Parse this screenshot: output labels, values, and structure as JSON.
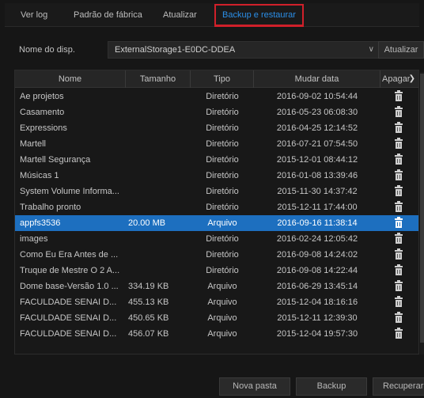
{
  "tabs": [
    {
      "label": "Ver log"
    },
    {
      "label": "Padrão de fábrica"
    },
    {
      "label": "Atualizar"
    },
    {
      "label": "Backup e restaurar",
      "active": true
    }
  ],
  "device": {
    "label": "Nome do disp.",
    "selected": "ExternalStorage1-E0DC-DDEA",
    "refresh_label": "Atualizar"
  },
  "table": {
    "columns": [
      "Nome",
      "Tamanho",
      "Tipo",
      "Mudar data",
      "Apagar"
    ],
    "rows": [
      {
        "name": "Ae projetos",
        "size": "",
        "type": "Diretório",
        "date": "2016-09-02 10:54:44"
      },
      {
        "name": "Casamento",
        "size": "",
        "type": "Diretório",
        "date": "2016-05-23 06:08:30"
      },
      {
        "name": "Expressions",
        "size": "",
        "type": "Diretório",
        "date": "2016-04-25 12:14:52"
      },
      {
        "name": "Martell",
        "size": "",
        "type": "Diretório",
        "date": "2016-07-21 07:54:50"
      },
      {
        "name": "Martell Segurança",
        "size": "",
        "type": "Diretório",
        "date": "2015-12-01 08:44:12"
      },
      {
        "name": "Músicas 1",
        "size": "",
        "type": "Diretório",
        "date": "2016-01-08 13:39:46"
      },
      {
        "name": "System Volume Informa...",
        "size": "",
        "type": "Diretório",
        "date": "2015-11-30 14:37:42"
      },
      {
        "name": "Trabalho pronto",
        "size": "",
        "type": "Diretório",
        "date": "2015-12-11 17:44:00"
      },
      {
        "name": "appfs3536",
        "size": "20.00 MB",
        "type": "Arquivo",
        "date": "2016-09-16 11:38:14",
        "selected": true
      },
      {
        "name": "images",
        "size": "",
        "type": "Diretório",
        "date": "2016-02-24 12:05:42"
      },
      {
        "name": "Como Eu Era Antes de ...",
        "size": "",
        "type": "Diretório",
        "date": "2016-09-08 14:24:02"
      },
      {
        "name": "Truque de Mestre O 2 A...",
        "size": "",
        "type": "Diretório",
        "date": "2016-09-08 14:22:44"
      },
      {
        "name": "Dome base-Versão 1.0 ...",
        "size": "334.19 KB",
        "type": "Arquivo",
        "date": "2016-06-29 13:45:14"
      },
      {
        "name": "FACULDADE SENAI D...",
        "size": "455.13 KB",
        "type": "Arquivo",
        "date": "2015-12-04 18:16:16"
      },
      {
        "name": "FACULDADE SENAI D...",
        "size": "450.65 KB",
        "type": "Arquivo",
        "date": "2015-12-11 12:39:30"
      },
      {
        "name": "FACULDADE SENAI D...",
        "size": "456.07 KB",
        "type": "Arquivo",
        "date": "2015-12-04 19:57:30"
      }
    ]
  },
  "buttons": {
    "new_folder": "Nova pasta",
    "backup": "Backup",
    "restore": "Recuperar"
  },
  "icons": {
    "delete": "trash-icon",
    "dropdown": "chevron-down-icon"
  },
  "colors": {
    "background": "#161616",
    "selected_row": "#1d6fbf",
    "active_tab_text": "#2b8fe8",
    "highlight_box": "#d0202a"
  }
}
